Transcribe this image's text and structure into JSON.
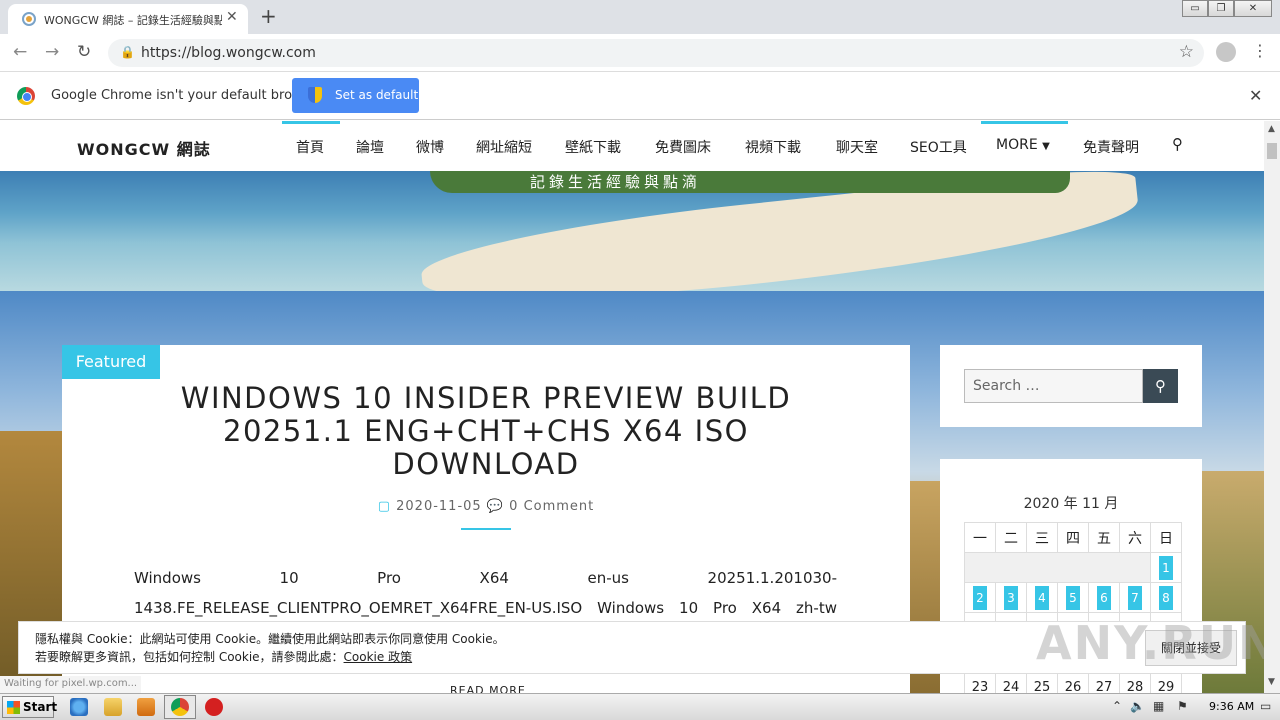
{
  "browser": {
    "tab_title": "WONGCW 網誌 – 記錄生活經驗與點",
    "tab_close": "✕",
    "new_tab": "+",
    "url": "https://blog.wongcw.com",
    "window_controls": [
      "▭",
      "❐",
      "✕"
    ]
  },
  "infobar": {
    "message": "Google Chrome isn't your default browser",
    "button": "Set as default",
    "close": "✕"
  },
  "site": {
    "logo": "WONGCW 網誌",
    "menu": [
      "首頁",
      "論壇",
      "微博",
      "網址縮短",
      "壁紙下載",
      "免費圖床",
      "視頻下載",
      "聊天室",
      "SEO工具",
      "MORE",
      "免責聲明"
    ],
    "tagline": "記錄生活經驗與點滴"
  },
  "post": {
    "badge": "Featured",
    "title": "WINDOWS 10 INSIDER PREVIEW BUILD 20251.1 ENG+CHT+CHS X64 ISO DOWNLOAD",
    "date": "2020-11-05",
    "comments": "0 Comment",
    "excerpt": "Windows 10 Pro X64 en-us 20251.1.201030-1438.FE_RELEASE_CLIENTPRO_OEMRET_X64FRE_EN-US.ISO Windows 10 Pro X64 zh-tw",
    "read_more": "READ MORE"
  },
  "sidebar": {
    "search_placeholder": "Search …",
    "calendar_title": "2020 年 11 月",
    "weekdays": [
      "一",
      "二",
      "三",
      "四",
      "五",
      "六",
      "日"
    ],
    "week1": [
      "",
      "",
      "",
      "",
      "",
      "",
      "1"
    ],
    "week2": [
      "2",
      "3",
      "4",
      "5",
      "6",
      "7",
      "8"
    ],
    "week5": [
      "23",
      "24",
      "25",
      "26",
      "27",
      "28",
      "29"
    ]
  },
  "cookie": {
    "line1": "隱私權與 Cookie：此網站可使用 Cookie。繼續使用此網站即表示你同意使用 Cookie。",
    "line2_prefix": "若要瞭解更多資訊，包括如何控制 Cookie，請參閱此處：",
    "line2_link": "Cookie 政策",
    "button": "關閉並接受"
  },
  "status_text": "Waiting for pixel.wp.com...",
  "watermark": "ANY.RUN",
  "taskbar": {
    "start": "Start",
    "clock": "9:36 AM"
  },
  "colors": {
    "accent": "#36c5e6",
    "chrome_button": "#4a8af4"
  }
}
